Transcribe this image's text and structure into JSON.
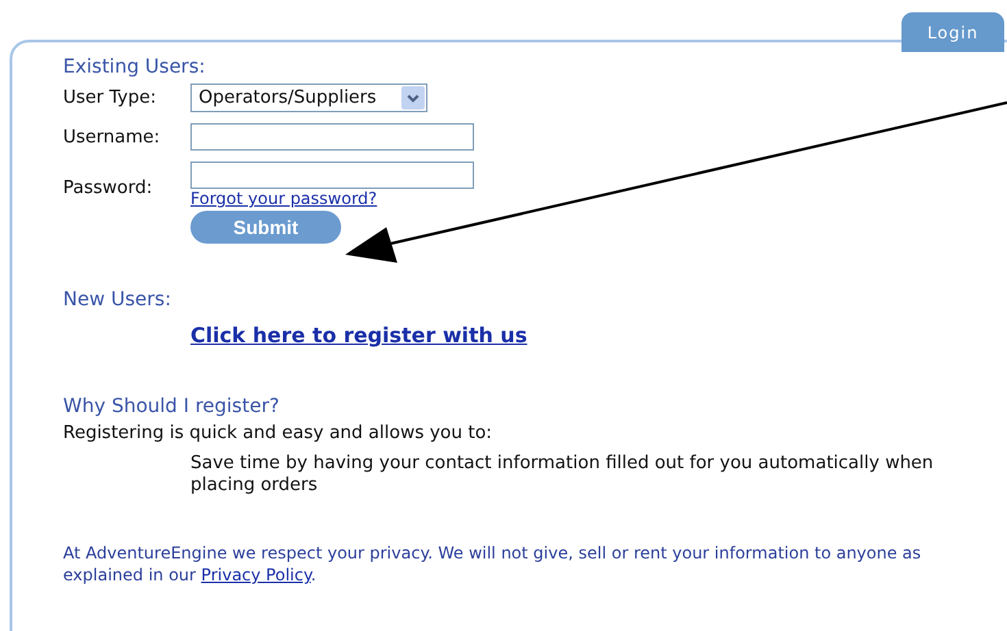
{
  "tabs": [
    {
      "label": "Login",
      "selected": true
    }
  ],
  "existing_users": {
    "heading": "Existing Users:",
    "fields": [
      {
        "kind": "select",
        "label": "User Type:",
        "value": "Operators/Suppliers"
      },
      {
        "kind": "text",
        "label": "Username:"
      },
      {
        "kind": "password",
        "label": "Password:"
      }
    ],
    "forgot_link": "Forgot your password?",
    "submit": "Submit"
  },
  "new_users": {
    "heading": "New Users:",
    "register_link": "Click here to register with us"
  },
  "why_register": {
    "heading": "Why Should I register?",
    "intro": "Registering is quick and easy and allows you to:",
    "benefits": [
      "Save time by having your contact information filled out for you automatically when placing orders"
    ]
  },
  "privacy": {
    "text": "At AdventureEngine we respect your privacy. We will not give, sell or rent your information to anyone as explained in our",
    "link": "Privacy Policy",
    "end": "."
  }
}
